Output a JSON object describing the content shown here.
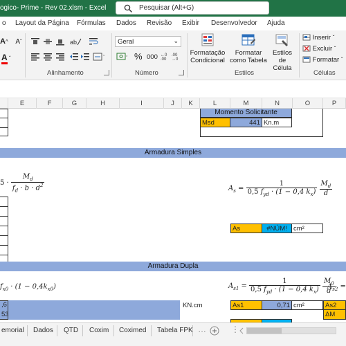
{
  "titlebar": {
    "title": "ogico- Prime - Rev 02.xlsm  -  Excel",
    "search_placeholder": "Pesquisar (Alt+G)"
  },
  "tabs": [
    "Layout da Página",
    "Fórmulas",
    "Dados",
    "Revisão",
    "Exibir",
    "Desenvolvedor",
    "Ajuda"
  ],
  "ribbon": {
    "groups": {
      "alignment": "Alinhamento",
      "number": "Número",
      "styles": "Estilos",
      "cells": "Células"
    },
    "number_format": "Geral",
    "percent": "%",
    "thousands": "000",
    "styles_buttons": {
      "cond_format": "Formatação Condicional",
      "table_format": "Formatar como Tabela",
      "cell_styles": "Estilos de Célula"
    },
    "cells_buttons": {
      "insert": "Inserir",
      "delete": "Excluir",
      "format": "Formatar"
    }
  },
  "columns": [
    "E",
    "F",
    "G",
    "H",
    "I",
    "J",
    "K",
    "L",
    "M",
    "N",
    "O",
    "P"
  ],
  "sheet": {
    "momento_header": "Momento Solicitante",
    "msd_label": "Msd",
    "msd_value": "441",
    "msd_unit": "Kn.m",
    "armadura_simples": "Armadura Simples",
    "armadura_dupla": "Armadura Dupla",
    "as_label": "As",
    "as_value": "#NÚM!",
    "as_unit": "cm²",
    "as1_label": "As1",
    "as1_value": "0,71",
    "as1_unit": "cm²",
    "as2_label": "As2",
    "dm_label": "ΔM",
    "left_val_1": ",6",
    "left_val_2": "53",
    "kn_cm": "KN.cm"
  },
  "sheettabs": [
    "emorial",
    "Dados",
    "QTD",
    "Coxim",
    "Coximed",
    "Tabela FPK"
  ],
  "colors": {
    "excel_green": "#217346",
    "band_blue": "#8ea9db",
    "orange": "#ffc000",
    "cyan": "#00b0f0"
  }
}
